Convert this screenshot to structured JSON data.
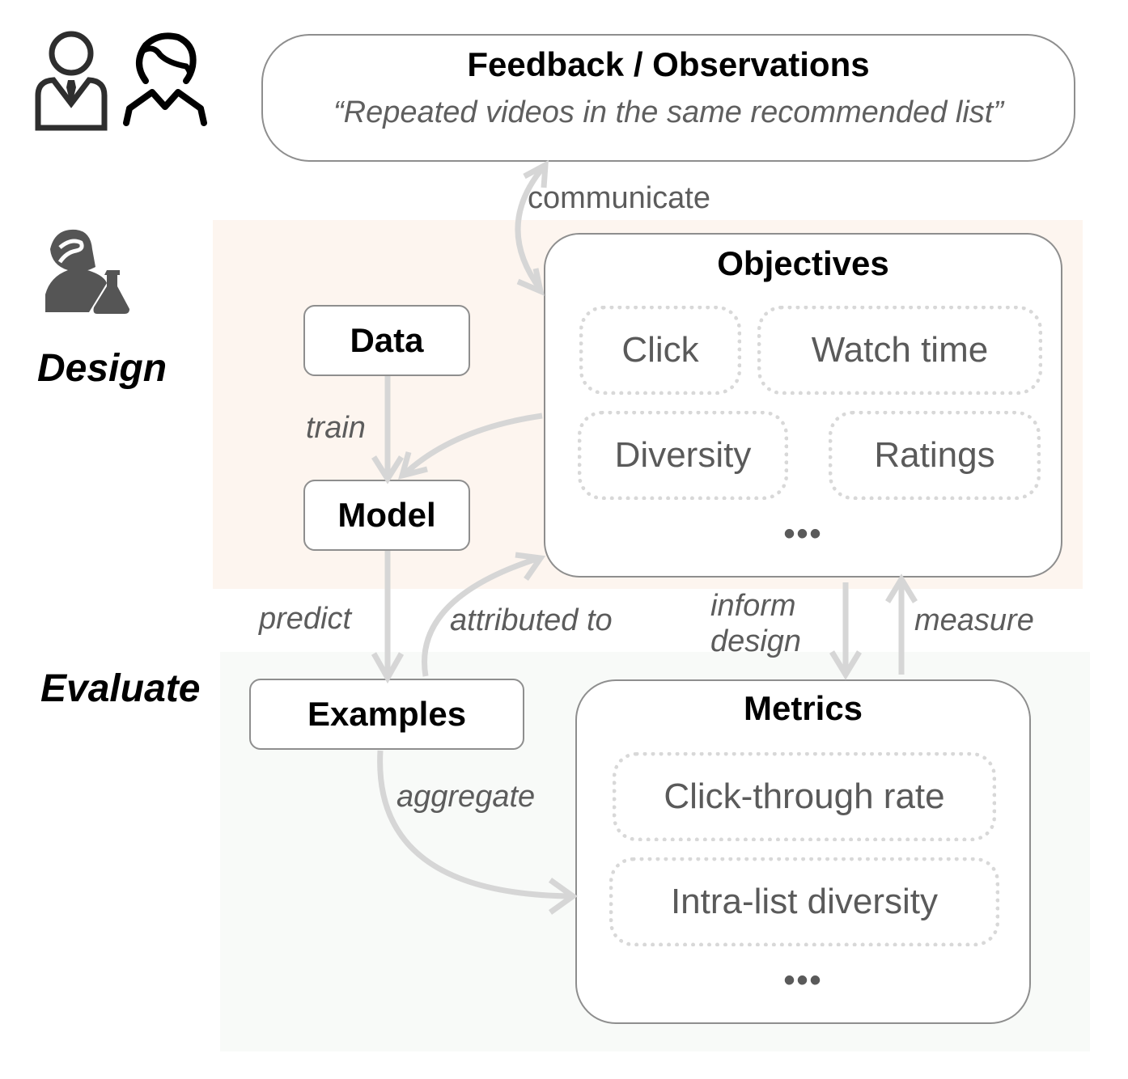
{
  "feedback": {
    "title": "Feedback / Observations",
    "quote": "“Repeated videos in the same recommended list”"
  },
  "stages": {
    "design": "Design",
    "evaluate": "Evaluate"
  },
  "nodes": {
    "data": "Data",
    "model": "Model",
    "examples": "Examples"
  },
  "objectives": {
    "title": "Objectives",
    "items": [
      "Click",
      "Watch time",
      "Diversity",
      "Ratings"
    ],
    "more": "•••"
  },
  "metrics": {
    "title": "Metrics",
    "items": [
      "Click-through rate",
      "Intra-list diversity"
    ],
    "more": "•••"
  },
  "edges": {
    "communicate": "communicate",
    "train": "train",
    "predict": "predict",
    "attributed_to": "attributed to",
    "inform_design_1": "inform",
    "inform_design_2": "design",
    "measure": "measure",
    "aggregate": "aggregate"
  },
  "icons": {
    "stakeholder": "businessman-icon",
    "user": "user-icon",
    "designer": "scientist-icon"
  },
  "colors": {
    "design_region": "#fdf5ef",
    "evaluate_region": "#f8faf8",
    "arrow": "#d6d6d6",
    "border": "#8e8e8e"
  }
}
